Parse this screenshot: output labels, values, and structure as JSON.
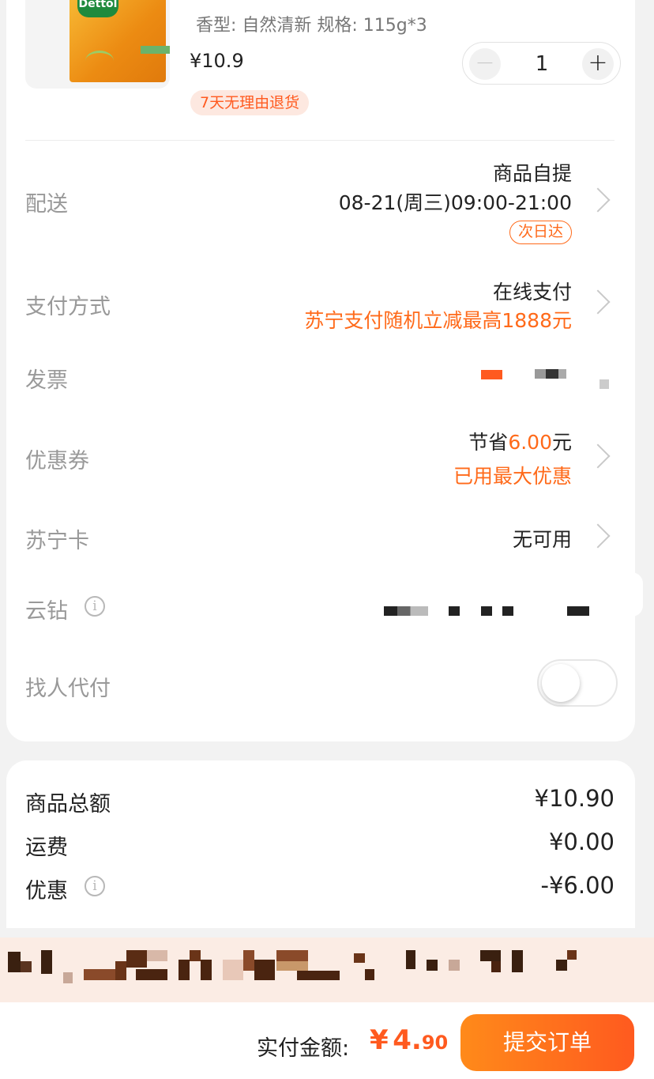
{
  "product": {
    "brand": "Dettol",
    "spec": "香型: 自然清新 规格: 115g*3",
    "price": "¥10.9",
    "quantity": "1",
    "minus": "−",
    "plus": "+",
    "return_badge": "7天无理由退货"
  },
  "delivery": {
    "label": "配送",
    "method": "商品自提",
    "time": "08-21(周三)09:00-21:00",
    "badge": "次日达"
  },
  "payment": {
    "label": "支付方式",
    "method": "在线支付",
    "promo": "苏宁支付随机立减最高1888元"
  },
  "invoice": {
    "label": "发票"
  },
  "coupon": {
    "label": "优惠券",
    "save_prefix": "节省",
    "save_amount": "6.00",
    "save_suffix": "元",
    "note": "已用最大优惠"
  },
  "suning_card": {
    "label": "苏宁卡",
    "value": "无可用"
  },
  "yunzuan": {
    "label": "云钻",
    "info_icon": "i"
  },
  "proxy_pay": {
    "label": "找人代付",
    "enabled": false
  },
  "summary": {
    "goods_total_label": "商品总额",
    "goods_total": "¥10.90",
    "shipping_label": "运费",
    "shipping": "¥0.00",
    "discount_label": "优惠",
    "discount": "-¥6.00",
    "info_icon": "i"
  },
  "footer": {
    "pay_label": "实付金额:",
    "currency": "¥",
    "amount_int": "4.",
    "amount_dec": "90",
    "submit": "提交订单"
  },
  "colors": {
    "accent": "#ff6a1a",
    "price": "#ff5a1f",
    "label_gray": "#999999"
  },
  "icons": [
    "chevron-right-icon",
    "info-icon",
    "minus-icon",
    "plus-icon",
    "toggle-switch"
  ]
}
